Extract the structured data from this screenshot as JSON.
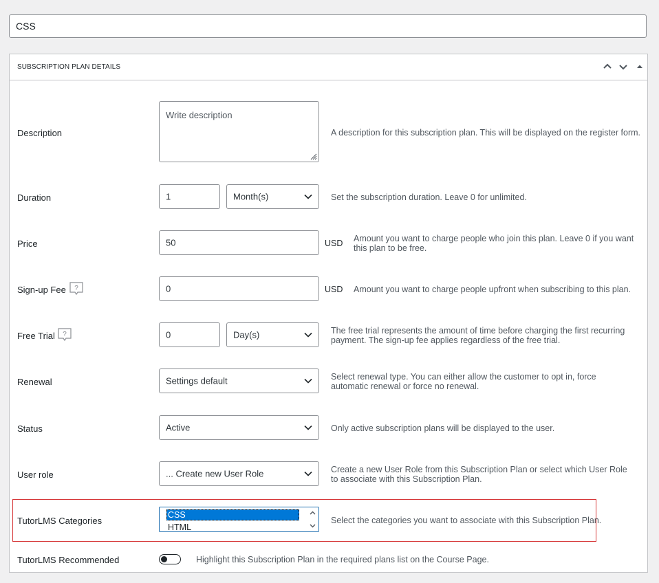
{
  "title_value": "CSS",
  "panel": {
    "title": "SUBSCRIPTION PLAN DETAILS",
    "controls": [
      "chevron-up-icon",
      "chevron-down-icon",
      "caret-up-icon"
    ]
  },
  "fields": {
    "description": {
      "label": "Description",
      "placeholder": "Write description",
      "help": "A description for this subscription plan. This will be displayed on the register form."
    },
    "duration": {
      "label": "Duration",
      "value": "1",
      "unit": "Month(s)",
      "help": "Set the subscription duration. Leave 0 for unlimited."
    },
    "price": {
      "label": "Price",
      "value": "50",
      "currency": "USD",
      "help": "Amount you want to charge people who join this plan. Leave 0 if you want this plan to be free."
    },
    "signup_fee": {
      "label": "Sign-up Fee",
      "value": "0",
      "currency": "USD",
      "help": "Amount you want to charge people upfront when subscribing to this plan."
    },
    "free_trial": {
      "label": "Free Trial",
      "value": "0",
      "unit": "Day(s)",
      "help": "The free trial represents the amount of time before charging the first recurring payment. The sign-up fee applies regardless of the free trial."
    },
    "renewal": {
      "label": "Renewal",
      "value": "Settings default",
      "help": "Select renewal type. You can either allow the customer to opt in, force automatic renewal or force no renewal."
    },
    "status": {
      "label": "Status",
      "value": "Active",
      "help": "Only active subscription plans will be displayed to the user."
    },
    "user_role": {
      "label": "User role",
      "value": "... Create new User Role",
      "help": "Create a new User Role from this Subscription Plan or select which User Role to associate with this Subscription Plan."
    },
    "tutor_categories": {
      "label": "TutorLMS Categories",
      "options": [
        "CSS",
        "HTML"
      ],
      "selected": "CSS",
      "help": "Select the categories you want to associate with this Subscription Plan."
    },
    "tutor_recommended": {
      "label": "TutorLMS Recommended",
      "enabled": false,
      "help": "Highlight this Subscription Plan in the required plans list on the Course Page."
    }
  },
  "colors": {
    "highlight_border": "#d63638",
    "selected_option": "#0078d7",
    "focus_border": "#2271b1"
  }
}
